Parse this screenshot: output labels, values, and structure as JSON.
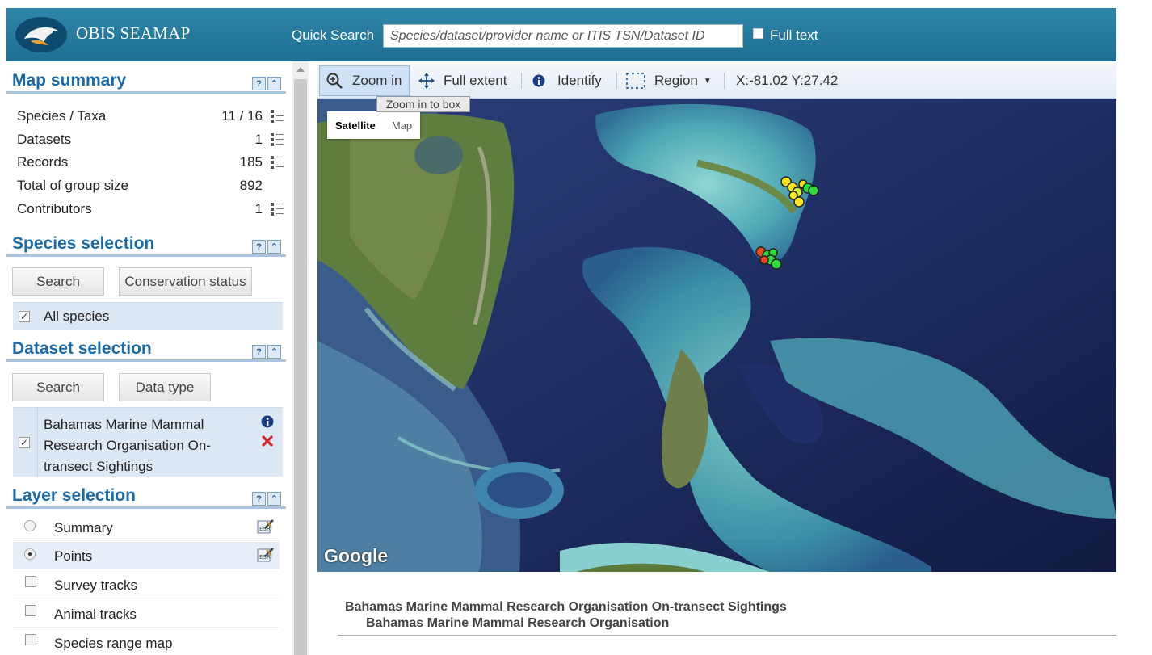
{
  "header": {
    "brand": "OBIS SEAMAP",
    "quick_search_label": "Quick Search",
    "quick_search_placeholder": "Species/dataset/provider name or ITIS TSN/Dataset ID",
    "full_text_label": "Full text",
    "full_text_checked": false,
    "colors": {
      "bar": "#2581a4",
      "text": "#ffffff"
    }
  },
  "map_summary": {
    "title": "Map summary",
    "rows": [
      {
        "label": "Species / Taxa",
        "value": "11 / 16",
        "list_icon": true
      },
      {
        "label": "Datasets",
        "value": "1",
        "list_icon": true
      },
      {
        "label": "Records",
        "value": "185",
        "list_icon": true
      },
      {
        "label": "Total of group size",
        "value": "892",
        "list_icon": false
      },
      {
        "label": "Contributors",
        "value": "1",
        "list_icon": true
      }
    ]
  },
  "species_selection": {
    "title": "Species selection",
    "search_label": "Search",
    "conservation_label": "Conservation status",
    "all_species_label": "All species",
    "all_species_checked": true
  },
  "dataset_selection": {
    "title": "Dataset selection",
    "search_label": "Search",
    "data_type_label": "Data type",
    "dataset_line1": "Bahamas Marine Mammal",
    "dataset_line2": "Research Organisation On-",
    "dataset_line3": "transect Sightings",
    "dataset_checked": true
  },
  "layer_selection": {
    "title": "Layer selection",
    "layers": [
      {
        "label": "Summary",
        "control": "radio",
        "on": false
      },
      {
        "label": "Points",
        "control": "radio",
        "on": true
      },
      {
        "label": "Survey tracks",
        "control": "checkbox",
        "on": false
      },
      {
        "label": "Animal tracks",
        "control": "checkbox",
        "on": false
      },
      {
        "label": "Species range map",
        "control": "checkbox",
        "on": false
      }
    ]
  },
  "toolbar": {
    "zoom_in": "Zoom in",
    "full_extent": "Full extent",
    "identify": "Identify",
    "region": "Region",
    "coordinates": "X:-81.02 Y:27.42",
    "tooltip": "Zoom in to box"
  },
  "map": {
    "satellite_label": "Satellite",
    "map_label": "Map",
    "active_type": "Satellite",
    "attribution": "Google"
  },
  "info": {
    "dataset_title": "Bahamas Marine Mammal Research Organisation On-transect Sightings",
    "provider": "Bahamas Marine Mammal Research Organisation"
  }
}
